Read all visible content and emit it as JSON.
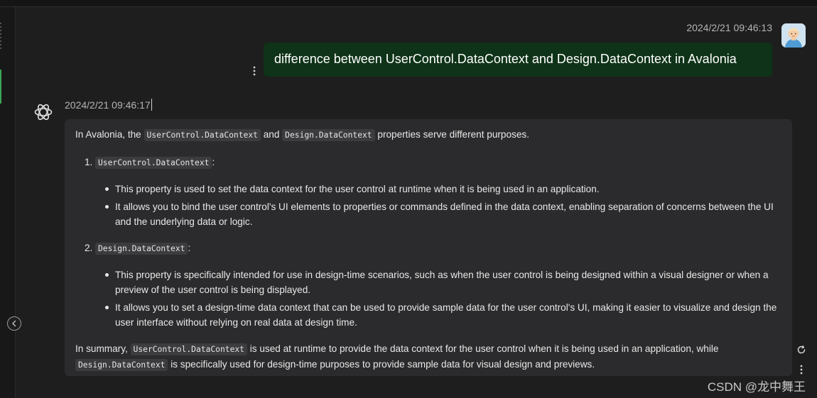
{
  "user_message": {
    "timestamp": "2024/2/21 09:46:13",
    "text": "difference between  UserControl.DataContext and Design.DataContext in Avalonia"
  },
  "ai_message": {
    "timestamp": "2024/2/21 09:46:17",
    "intro": {
      "pre": "In Avalonia, the ",
      "code1": "UserControl.DataContext",
      "mid": " and ",
      "code2": "Design.DataContext",
      "post": " properties serve different purposes."
    },
    "items": [
      {
        "number": "1.",
        "code": "UserControl.DataContext",
        "suffix": ":",
        "bullets": [
          "This property is used to set the data context for the user control at runtime when it is being used in an application.",
          "It allows you to bind the user control's UI elements to properties or commands defined in the data context, enabling separation of concerns between the UI and the underlying data or logic."
        ]
      },
      {
        "number": "2.",
        "code": "Design.DataContext",
        "suffix": ":",
        "bullets": [
          "This property is specifically intended for use in design-time scenarios, such as when the user control is being designed within a visual designer or when a preview of the user control is being displayed.",
          "It allows you to set a design-time data context that can be used to provide sample data for the user control's UI, making it easier to visualize and design the user interface without relying on real data at design time."
        ]
      }
    ],
    "summary": {
      "pre": "In summary, ",
      "code1": "UserControl.DataContext",
      "mid": " is used at runtime to provide the data context for the user control when it is being used in an application, while ",
      "code2": "Design.DataContext",
      "post": " is specifically used for design-time purposes to provide sample data for visual design and previews."
    }
  },
  "icons": {
    "collapse": "chevron-left-icon",
    "avatar": "user-avatar",
    "ai": "openai-logo-icon",
    "refresh": "refresh-icon",
    "more": "more-vertical-icon"
  },
  "colors": {
    "background": "#1e1e1e",
    "user_bubble": "#0f3318",
    "ai_bubble": "#2b2b2d",
    "accent": "#3aa655"
  },
  "watermark": "CSDN @龙中舞王"
}
